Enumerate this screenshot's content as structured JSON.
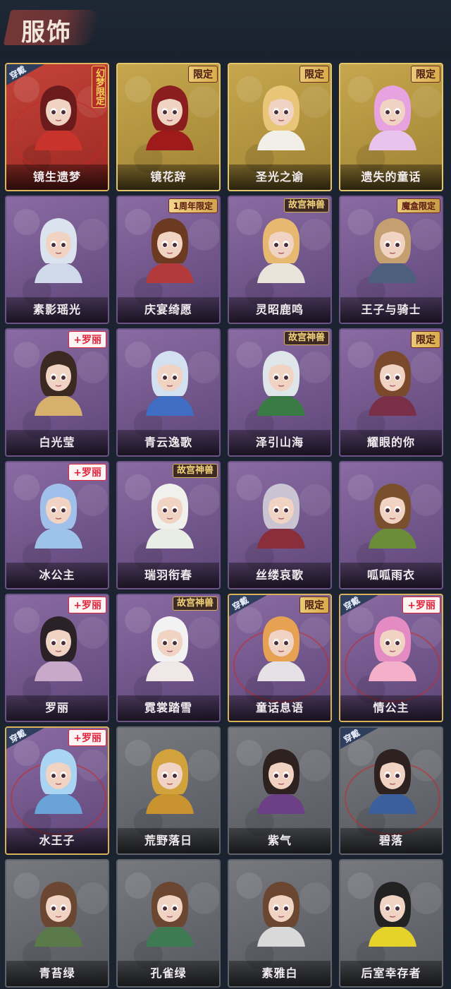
{
  "header": {
    "title": "服饰"
  },
  "worn_label": "穿戴",
  "badges": {
    "limited": "限定",
    "anniv": "1周年限定",
    "mohe": "魔盒限定",
    "gugong": "故宫神兽",
    "luoli": "+罗丽",
    "mengling": "幻梦限定"
  },
  "outfits": [
    {
      "name": "镜生遗梦",
      "badge": "mengling",
      "tier": "red",
      "worn": true
    },
    {
      "name": "镜花辞",
      "badge": "limited",
      "tier": "gold",
      "worn": false
    },
    {
      "name": "圣光之谕",
      "badge": "limited",
      "tier": "gold",
      "worn": false
    },
    {
      "name": "遗失的童话",
      "badge": "limited",
      "tier": "gold",
      "worn": false
    },
    {
      "name": "素影瑶光",
      "badge": "",
      "tier": "purple",
      "worn": false
    },
    {
      "name": "庆宴绮愿",
      "badge": "anniv",
      "tier": "purple",
      "worn": false
    },
    {
      "name": "灵昭鹿鸣",
      "badge": "gugong",
      "tier": "purple",
      "worn": false
    },
    {
      "name": "王子与骑士",
      "badge": "mohe",
      "tier": "purple",
      "worn": false
    },
    {
      "name": "白光莹",
      "badge": "luoli",
      "tier": "purple",
      "worn": false
    },
    {
      "name": "青云逸歌",
      "badge": "",
      "tier": "purple",
      "worn": false
    },
    {
      "name": "泽引山海",
      "badge": "gugong",
      "tier": "purple",
      "worn": false
    },
    {
      "name": "耀眼的你",
      "badge": "limited",
      "tier": "purple",
      "worn": false
    },
    {
      "name": "冰公主",
      "badge": "luoli",
      "tier": "purple",
      "worn": false
    },
    {
      "name": "瑞羽衔春",
      "badge": "gugong",
      "tier": "purple",
      "worn": false
    },
    {
      "name": "丝缕哀歌",
      "badge": "",
      "tier": "purple",
      "worn": false
    },
    {
      "name": "呱呱雨衣",
      "badge": "",
      "tier": "purple",
      "worn": false
    },
    {
      "name": "罗丽",
      "badge": "luoli",
      "tier": "purple",
      "worn": false
    },
    {
      "name": "霓裳踏雪",
      "badge": "gugong",
      "tier": "purple",
      "worn": false
    },
    {
      "name": "童话息语",
      "badge": "limited",
      "tier": "purple",
      "worn": true
    },
    {
      "name": "情公主",
      "badge": "luoli",
      "tier": "purple",
      "worn": true
    },
    {
      "name": "水王子",
      "badge": "luoli",
      "tier": "purple",
      "worn": true
    },
    {
      "name": "荒野落日",
      "badge": "",
      "tier": "gray",
      "worn": false
    },
    {
      "name": "紫气",
      "badge": "",
      "tier": "gray",
      "worn": false
    },
    {
      "name": "碧落",
      "badge": "",
      "tier": "gray",
      "worn": true
    },
    {
      "name": "青苔绿",
      "badge": "",
      "tier": "gray",
      "worn": false
    },
    {
      "name": "孔雀绿",
      "badge": "",
      "tier": "gray",
      "worn": false
    },
    {
      "name": "素雅白",
      "badge": "",
      "tier": "gray",
      "worn": false
    },
    {
      "name": "后室幸存者",
      "badge": "",
      "tier": "gray",
      "worn": false
    }
  ],
  "colors": {
    "hair": [
      "#6b1b1b",
      "#8a1e1e",
      "#e8c577",
      "#e7a3e0",
      "#dbe3ee",
      "#6b3a21",
      "#e6b870",
      "#c4a071",
      "#3b2a22",
      "#d3e0f0",
      "#dfe6ea",
      "#7b4a2c",
      "#9fc0ea",
      "#f0f0ec",
      "#c9c3d2",
      "#7a4f2e",
      "#2b2228",
      "#f2f2f2",
      "#e7a152",
      "#e58bc4",
      "#a9d4f2",
      "#d2a23c",
      "#2e2220",
      "#2e2220",
      "#6b4630",
      "#6b4630",
      "#6b4630",
      "#222222"
    ],
    "outfit": [
      "#c8332b",
      "#9f1b1b",
      "#f2efe8",
      "#e8c3ec",
      "#cfd9ea",
      "#b23a3a",
      "#e9e4d9",
      "#4c5f7d",
      "#d6b06c",
      "#3f6ec4",
      "#3a7a44",
      "#7a2f48",
      "#9ec3ea",
      "#e8eee3",
      "#8a2e3c",
      "#6b8d3a",
      "#c9a9c9",
      "#efe8e6",
      "#e6e1e4",
      "#f3b0c8",
      "#6aa3d8",
      "#c9932f",
      "#6c3f86",
      "#3a5f9c",
      "#5a7a4a",
      "#3e7a52",
      "#d9d9d9",
      "#e5d22a"
    ]
  }
}
